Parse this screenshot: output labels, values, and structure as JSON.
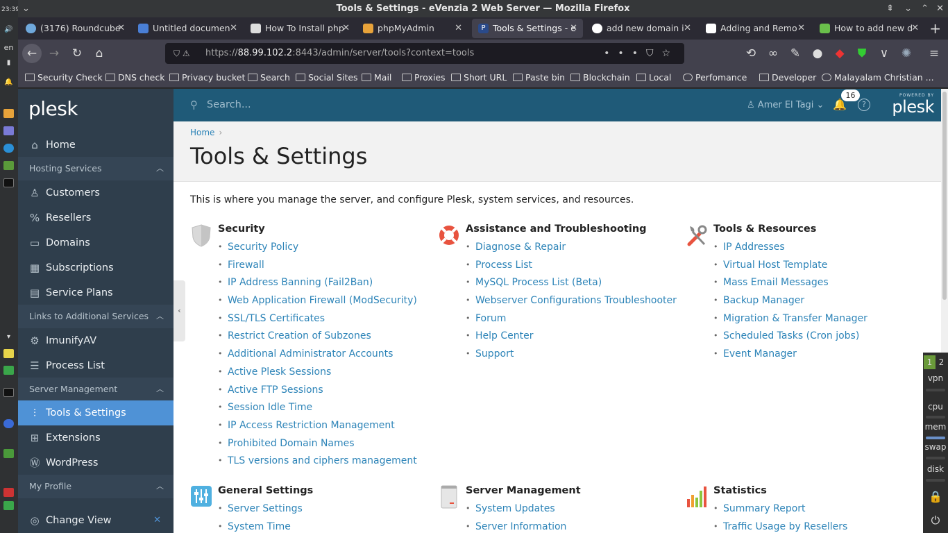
{
  "desktop": {
    "clock": "23:39",
    "keyboard_layout": "en"
  },
  "window": {
    "title": "Tools & Settings - eVenzia 2 Web Server — Mozilla Firefox"
  },
  "tabs": [
    {
      "label": "(3176) Roundcube",
      "favicon_color": "#6fa8dc"
    },
    {
      "label": "Untitled documen",
      "favicon_color": "#4a7fd6"
    },
    {
      "label": "How To Install php",
      "favicon_color": "#ddd"
    },
    {
      "label": "phpMyAdmin",
      "favicon_color": "#e8a33a"
    },
    {
      "label": "Tools & Settings - e",
      "favicon_color": "#42414d",
      "active": true
    },
    {
      "label": "add new domain i",
      "favicon_color": "#ffffff"
    },
    {
      "label": "Adding and Remo",
      "favicon_color": "#ffffff"
    },
    {
      "label": "How to add new d",
      "favicon_color": "#6abf4b"
    }
  ],
  "navbar": {
    "url_prefix": "https://",
    "url_host": "88.99.102.2",
    "url_rest": ":8443/admin/server/tools?context=tools"
  },
  "bookmarks": [
    "Security Check",
    "DNS check",
    "Privacy bucket",
    "Search",
    "Social Sites",
    "Mail",
    "Proxies",
    "Short URL",
    "Paste bin",
    "Blockchain",
    "Local",
    "Perfomance",
    "Developer",
    "Malayalam Christian ..."
  ],
  "plesk": {
    "logo": "plesk",
    "search_placeholder": "Search...",
    "user_name": "Amer El Tagi",
    "notification_count": "16",
    "powered_by": "POWERED BY",
    "powered_logo": "plesk",
    "breadcrumb_home": "Home",
    "page_title": "Tools & Settings",
    "intro": "This is where you manage the server, and configure Plesk, system services, and resources.",
    "sidebar": {
      "home": "Home",
      "group_hosting": "Hosting Services",
      "customers": "Customers",
      "resellers": "Resellers",
      "domains": "Domains",
      "subscriptions": "Subscriptions",
      "service_plans": "Service Plans",
      "group_links": "Links to Additional Services",
      "imunifyav": "ImunifyAV",
      "process_list": "Process List",
      "group_server": "Server Management",
      "tools_settings": "Tools & Settings",
      "extensions": "Extensions",
      "wordpress": "WordPress",
      "group_profile": "My Profile",
      "change_view": "Change View"
    },
    "sections": {
      "security": {
        "title": "Security",
        "items": [
          "Security Policy",
          "Firewall",
          "IP Address Banning (Fail2Ban)",
          "Web Application Firewall (ModSecurity)",
          "SSL/TLS Certificates",
          "Restrict Creation of Subzones",
          "Additional Administrator Accounts",
          "Active Plesk Sessions",
          "Active FTP Sessions",
          "Session Idle Time",
          "IP Access Restriction Management",
          "Prohibited Domain Names",
          "TLS versions and ciphers management"
        ]
      },
      "assistance": {
        "title": "Assistance and Troubleshooting",
        "items": [
          "Diagnose & Repair",
          "Process List",
          "MySQL Process List (Beta)",
          "Webserver Configurations Troubleshooter",
          "Forum",
          "Help Center",
          "Support"
        ]
      },
      "tools": {
        "title": "Tools & Resources",
        "items": [
          "IP Addresses",
          "Virtual Host Template",
          "Mass Email Messages",
          "Backup Manager",
          "Migration & Transfer Manager",
          "Scheduled Tasks (Cron jobs)",
          "Event Manager"
        ]
      },
      "general": {
        "title": "General Settings",
        "items": [
          "Server Settings",
          "System Time"
        ]
      },
      "server_mgmt": {
        "title": "Server Management",
        "items": [
          "System Updates",
          "Server Information"
        ]
      },
      "statistics": {
        "title": "Statistics",
        "items": [
          "Summary Report",
          "Traffic Usage by Resellers"
        ]
      }
    }
  },
  "sysmon": {
    "ws1": "1",
    "ws2": "2",
    "vpn": "vpn",
    "cpu": "cpu",
    "mem": "mem",
    "swap": "swap",
    "disk": "disk"
  },
  "colors": {
    "sidebar": "#2f3e4c",
    "accent": "#4f92d6",
    "topbar": "#1f5a78",
    "link": "#2d84b8"
  }
}
